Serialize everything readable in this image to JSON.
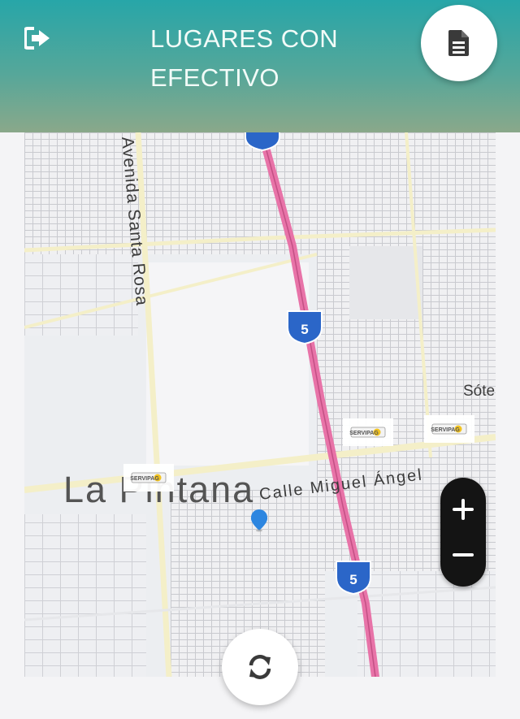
{
  "header": {
    "title": "LUGARES CON EFECTIVO",
    "logout_icon": "sign-out-icon",
    "document_icon": "file-document-icon",
    "gradient": [
      "#27a6a8",
      "#8aa88a"
    ]
  },
  "map": {
    "place_label": "La Pintana",
    "street_labels": {
      "avenida_santa_rosa": "Avenida Santa Rosa",
      "calle_miguel_angel": "Calle Miguel Ángel",
      "sotero": "Sóte"
    },
    "highway_shield": "5",
    "poi_logo": "SERVIPAG",
    "highway_color": "#e873a8",
    "marker_color": "#2d86e0",
    "zoom_in_icon": "plus-icon",
    "zoom_out_icon": "minus-icon"
  },
  "footer": {
    "refresh_icon": "refresh-icon"
  }
}
